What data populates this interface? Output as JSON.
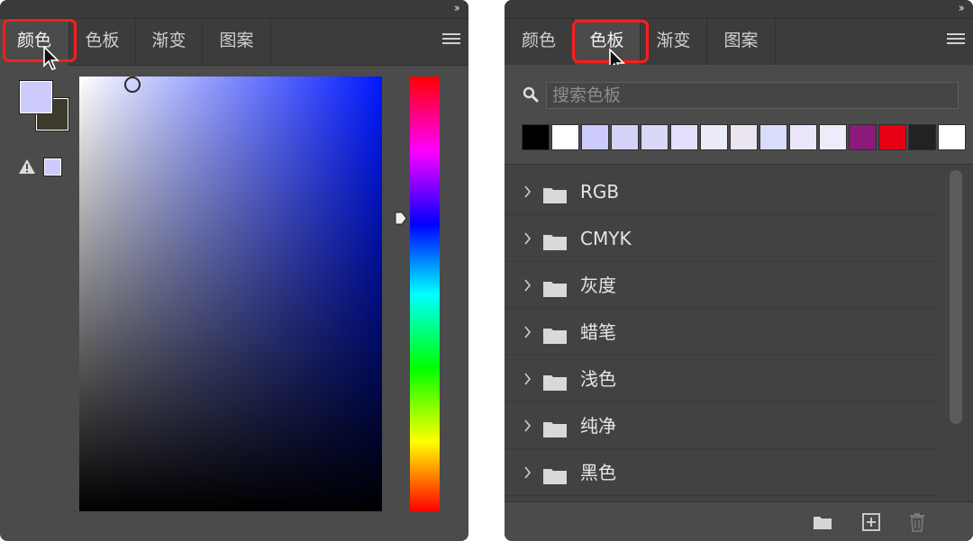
{
  "colors": {
    "highlight": "#ff1d1d",
    "foreground": "#cccbfb",
    "background": "#3d3a2b",
    "panel": "#4b4b4b"
  },
  "left_panel": {
    "tabs": [
      {
        "label": "颜色",
        "active": true
      },
      {
        "label": "色板",
        "active": false
      },
      {
        "label": "渐变",
        "active": false
      },
      {
        "label": "图案",
        "active": false
      }
    ],
    "icons": {
      "collapse": "double-chevron-right-icon",
      "menu": "hamburger-menu-icon",
      "warning": "out-of-gamut-warning-icon"
    }
  },
  "right_panel": {
    "tabs": [
      {
        "label": "颜色",
        "active": false
      },
      {
        "label": "色板",
        "active": true
      },
      {
        "label": "渐变",
        "active": false
      },
      {
        "label": "图案",
        "active": false
      }
    ],
    "search": {
      "placeholder": "搜索色板",
      "value": ""
    },
    "recent_swatches": [
      "#000000",
      "#ffffff",
      "#cccbfb",
      "#d3d3fa",
      "#d8d8f8",
      "#e2e0fb",
      "#ecebf9",
      "#ebe5f1",
      "#d9dcfa",
      "#ebe6fb",
      "#ececfa",
      "#8b1a7a",
      "#e60012",
      "#222222",
      "#ffffff"
    ],
    "groups": [
      "RGB",
      "CMYK",
      "灰度",
      "蜡笔",
      "浅色",
      "纯净",
      "黑色"
    ],
    "footer_icons": [
      "new-group-folder-icon",
      "new-swatch-icon",
      "delete-trash-icon"
    ]
  }
}
